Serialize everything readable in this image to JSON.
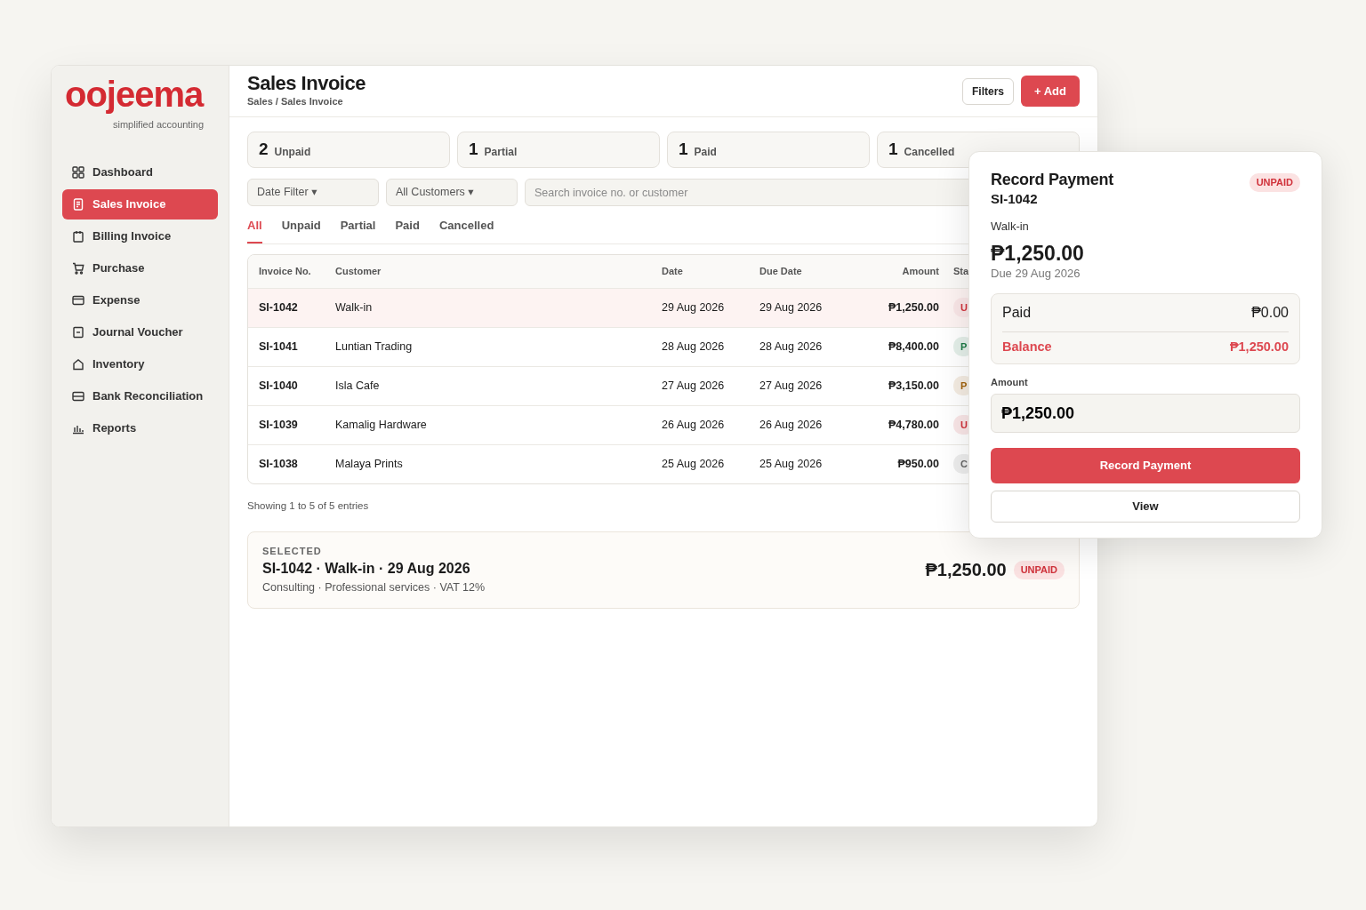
{
  "app": {
    "logo": "oojeema",
    "tagline": "simplified accounting"
  },
  "sidebar": {
    "items": [
      {
        "label": "Dashboard",
        "selected": false
      },
      {
        "label": "Sales Invoice",
        "selected": true
      },
      {
        "label": "Billing Invoice",
        "selected": false
      },
      {
        "label": "Purchase",
        "selected": false
      },
      {
        "label": "Expense",
        "selected": false
      },
      {
        "label": "Journal Voucher",
        "selected": false
      },
      {
        "label": "Inventory",
        "selected": false
      },
      {
        "label": "Bank Reconciliation",
        "selected": false
      },
      {
        "label": "Reports",
        "selected": false
      }
    ]
  },
  "header": {
    "title": "Sales Invoice",
    "breadcrumb": "Sales / Sales Invoice",
    "buttons": [
      {
        "label": "Filters",
        "kind": "outline"
      },
      {
        "label": "+ Add",
        "kind": "primary"
      }
    ]
  },
  "summary": [
    {
      "count": "2",
      "label": "Unpaid"
    },
    {
      "count": "1",
      "label": "Partial"
    },
    {
      "count": "1",
      "label": "Paid"
    },
    {
      "count": "1",
      "label": "Cancelled"
    }
  ],
  "filters": {
    "dropdowns": [
      "Date Filter ▾",
      "All Customers ▾"
    ],
    "search": {
      "placeholder": "Search invoice no. or customer"
    }
  },
  "tabs": [
    {
      "label": "All",
      "selected": true
    },
    {
      "label": "Unpaid",
      "selected": false
    },
    {
      "label": "Partial",
      "selected": false
    },
    {
      "label": "Paid",
      "selected": false
    },
    {
      "label": "Cancelled",
      "selected": false
    }
  ],
  "table": {
    "columns": [
      "Invoice No.",
      "Customer",
      "Date",
      "Due Date",
      "Amount",
      "Sta"
    ],
    "rows": [
      {
        "invoice": "SI-1042",
        "customer": "Walk-in",
        "date": "29 Aug 2026",
        "due": "29 Aug 2026",
        "amount": "₱1,250.00",
        "status": "U",
        "color": "#d0313a",
        "selected": true
      },
      {
        "invoice": "SI-1041",
        "customer": "Luntian Trading",
        "date": "28 Aug 2026",
        "due": "28 Aug 2026",
        "amount": "₱8,400.00",
        "status": "P",
        "color": "#1e7a45",
        "selected": false
      },
      {
        "invoice": "SI-1040",
        "customer": "Isla Cafe",
        "date": "27 Aug 2026",
        "due": "27 Aug 2026",
        "amount": "₱3,150.00",
        "status": "P",
        "color": "#a0620c",
        "selected": false
      },
      {
        "invoice": "SI-1039",
        "customer": "Kamalig Hardware",
        "date": "26 Aug 2026",
        "due": "26 Aug 2026",
        "amount": "₱4,780.00",
        "status": "U",
        "color": "#d0313a",
        "selected": false
      },
      {
        "invoice": "SI-1038",
        "customer": "Malaya Prints",
        "date": "25 Aug 2026",
        "due": "25 Aug 2026",
        "amount": "₱950.00",
        "status": "C",
        "color": "#666666",
        "selected": false
      }
    ]
  },
  "entries_text": "Showing 1 to 5 of 5 entries",
  "selected_card": {
    "label": "SELECTED",
    "title": "SI-1042 · Walk-in · 29 Aug 2026",
    "details": "Consulting · Professional services · VAT 12%",
    "amount": "₱1,250.00",
    "status": "UNPAID"
  },
  "payment_panel": {
    "title": "Record Payment",
    "invoice": "SI-1042",
    "status": "UNPAID",
    "customer": "Walk-in",
    "amount": "₱1,250.00",
    "due": "Due 29 Aug 2026",
    "paid_label": "Paid",
    "paid_value": "₱0.00",
    "balance_label": "Balance",
    "balance_value": "₱1,250.00",
    "field_label": "Amount",
    "field_value": "₱1,250.00",
    "buttons": [
      {
        "label": "Record Payment",
        "kind": "primary"
      },
      {
        "label": "View",
        "kind": "outline"
      }
    ]
  }
}
